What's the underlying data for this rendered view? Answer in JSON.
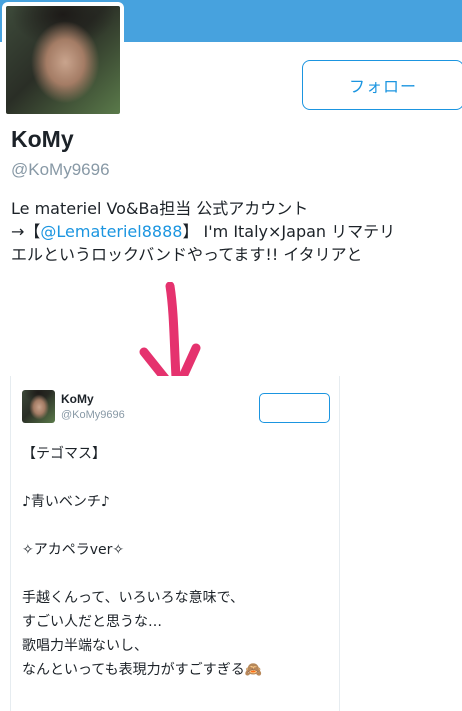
{
  "profile": {
    "display_name": "KoMy",
    "handle": "@KoMy9696",
    "follow_label": "フォロー",
    "bio": {
      "line1": "Le materiel Vo&Ba担当 公式アカウント",
      "line2_prefix": "→【",
      "line2_mention": "@Lemateriel8888",
      "line2_suffix": "】 I'm Italy×Japan リマテリ",
      "line3": "エルというロックバンドやってます!! イタリアと"
    },
    "colors": {
      "header": "#47a2de",
      "accent": "#1b95e0",
      "muted": "#8899a6",
      "arrow": "#e5326e"
    }
  },
  "card": {
    "display_name": "KoMy",
    "handle": "@KoMy9696",
    "tweet_lines": [
      "【テゴマス】",
      "",
      "♪青いベンチ♪",
      "",
      "✧アカペラver✧",
      "",
      "手越くんって、いろいろな意味で、",
      "すごい人だと思うな…",
      "歌唱力半端ないし、",
      "なんといっても表現力がすごすぎる🙈"
    ]
  },
  "icons": {
    "avatar": "profile-photo",
    "arrow": "down-arrow"
  }
}
